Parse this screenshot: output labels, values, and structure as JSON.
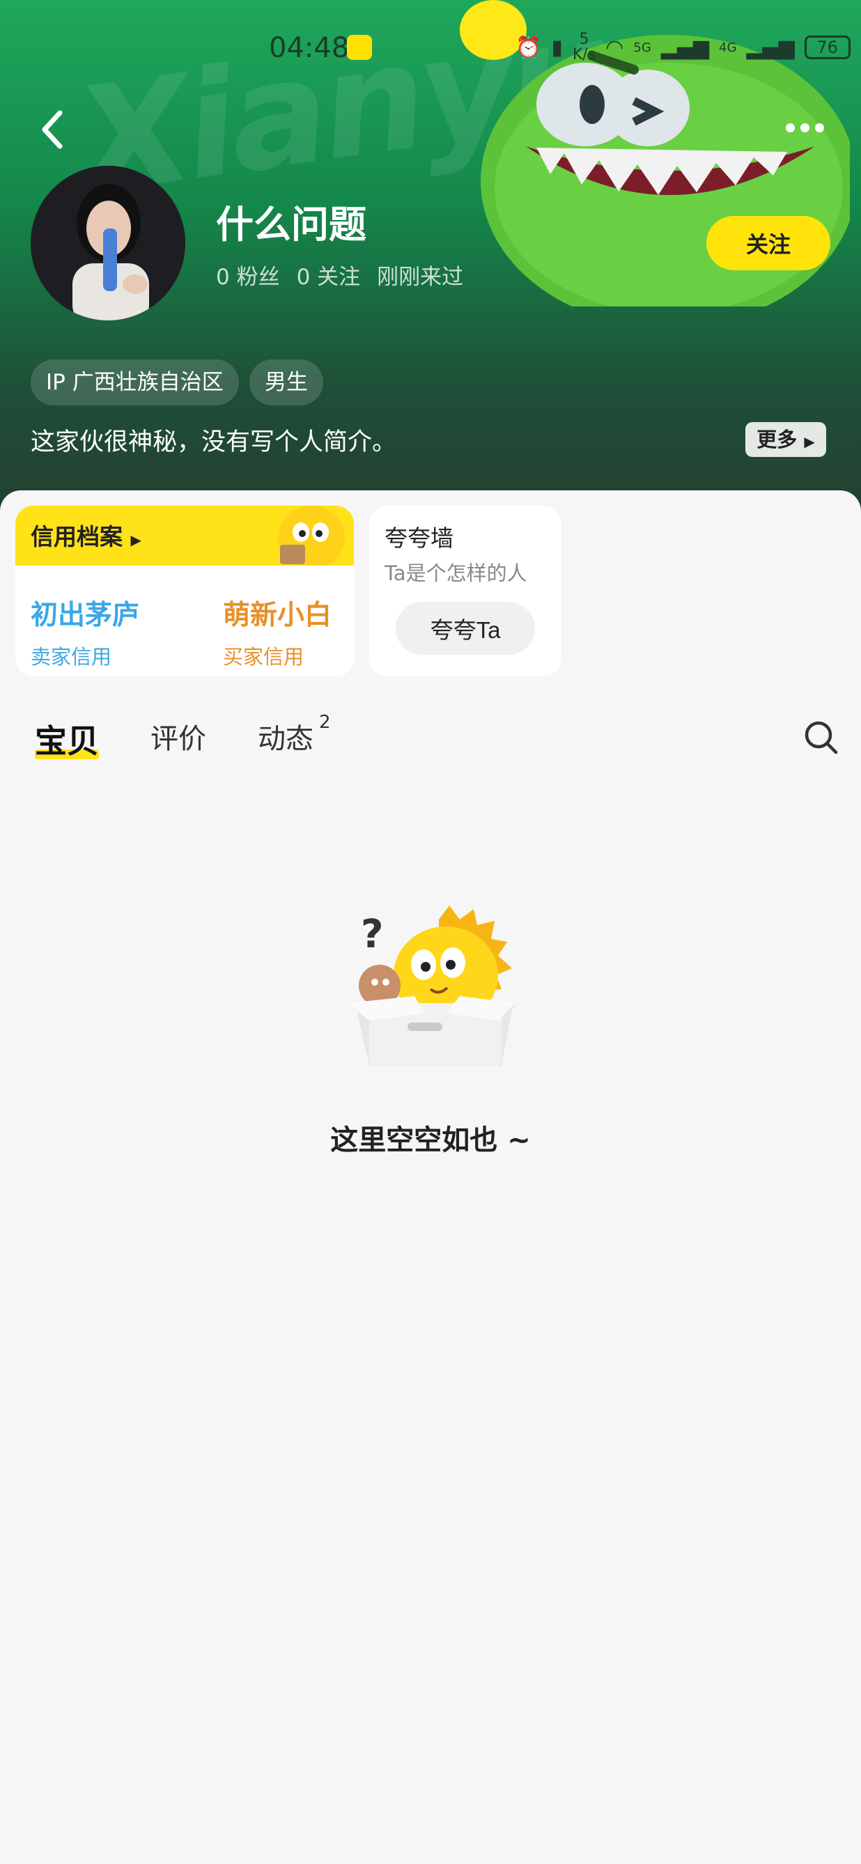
{
  "status_bar": {
    "time": "04:48",
    "speed_top": "5",
    "speed_unit": "K/s",
    "net1": "5G",
    "net2": "4G",
    "battery": "76"
  },
  "header": {
    "bg_word": "Xianyu",
    "username": "什么问题",
    "followers": "0 粉丝",
    "following": "0 关注",
    "last_seen": "刚刚来过",
    "follow_label": "关注",
    "tags": [
      "IP 广西壮族自治区",
      "男生"
    ],
    "bio": "这家伙很神秘，没有写个人简介。",
    "more_label": "更多"
  },
  "credit": {
    "title": "信用档案",
    "seller_level": "初出茅庐",
    "seller_label": "卖家信用",
    "buyer_level": "萌新小白",
    "buyer_label": "买家信用"
  },
  "praise": {
    "title": "夸夸墙",
    "subtitle": "Ta是个怎样的人",
    "button": "夸夸Ta"
  },
  "tabs": {
    "goods": "宝贝",
    "reviews": "评价",
    "feed": "动态",
    "feed_badge": "2"
  },
  "empty": {
    "text": "这里空空如也 ~"
  },
  "colors": {
    "accent": "#ffe218",
    "header_green": "#1fa85c",
    "seller_blue": "#3ba7e6",
    "buyer_orange": "#e8902a"
  }
}
